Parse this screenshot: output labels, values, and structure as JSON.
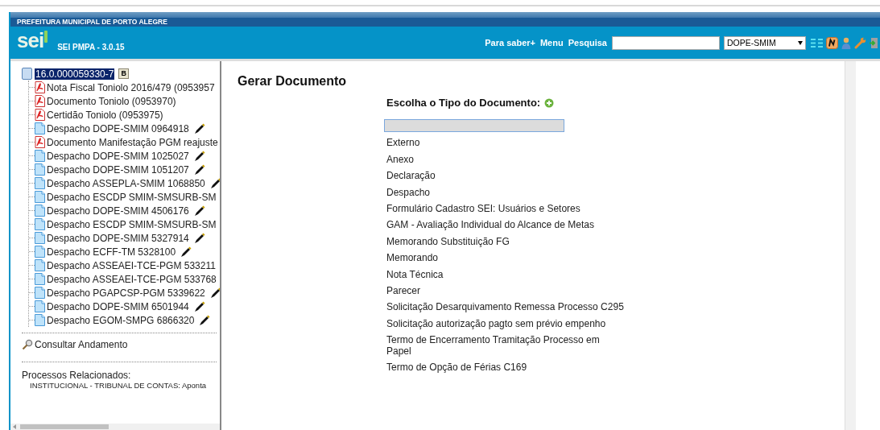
{
  "header": {
    "organization": "PREFEITURA MUNICIPAL DE PORTO ALEGRE",
    "logo": "sei",
    "version": "SEI PMPA - 3.0.15",
    "links": [
      "Para saber+",
      "Menu",
      "Pesquisa"
    ],
    "unit_select": {
      "value": "DOPE-SMIM"
    }
  },
  "tree": {
    "root": {
      "label": "16.0.000059330-7",
      "selected": true,
      "badge": "B",
      "children": [
        {
          "label": "Nota Fiscal Toniolo 2016/479 (0953957",
          "kind": "pdf",
          "signed": false
        },
        {
          "label": "Documento Toniolo (0953970)",
          "kind": "pdf",
          "signed": false
        },
        {
          "label": "Certidão Toniolo (0953975)",
          "kind": "pdf",
          "signed": false
        },
        {
          "label": "Despacho DOPE-SMIM 0964918",
          "kind": "doc",
          "signed": true
        },
        {
          "label": "Documento Manifestação PGM reajuste",
          "kind": "pdf",
          "signed": false
        },
        {
          "label": "Despacho DOPE-SMIM 1025027",
          "kind": "doc",
          "signed": true
        },
        {
          "label": "Despacho DOPE-SMIM 1051207",
          "kind": "doc",
          "signed": true
        },
        {
          "label": "Despacho ASSEPLA-SMIM 1068850",
          "kind": "doc",
          "signed": true
        },
        {
          "label": "Despacho ESCDP SMIM-SMSURB-SM",
          "kind": "doc",
          "signed": false
        },
        {
          "label": "Despacho DOPE-SMIM 4506176",
          "kind": "doc",
          "signed": true
        },
        {
          "label": "Despacho ESCDP SMIM-SMSURB-SM",
          "kind": "doc",
          "signed": false
        },
        {
          "label": "Despacho DOPE-SMIM 5327914",
          "kind": "doc",
          "signed": true
        },
        {
          "label": "Despacho ECFF-TM 5328100",
          "kind": "doc",
          "signed": true
        },
        {
          "label": "Despacho ASSEAEI-TCE-PGM 533211",
          "kind": "doc",
          "signed": false
        },
        {
          "label": "Despacho ASSEAEI-TCE-PGM 533768",
          "kind": "doc",
          "signed": false
        },
        {
          "label": "Despacho PGAPCSP-PGM 5339622",
          "kind": "doc",
          "signed": true
        },
        {
          "label": "Despacho DOPE-SMIM 6501944",
          "kind": "doc",
          "signed": true
        },
        {
          "label": "Despacho EGOM-SMPG 6866320",
          "kind": "doc",
          "signed": true
        }
      ]
    }
  },
  "consult_link": "Consultar Andamento",
  "related": {
    "title": "Processos Relacionados:",
    "items": [
      "INSTITUCIONAL - TRIBUNAL DE CONTAS: Aponta"
    ]
  },
  "main": {
    "title": "Gerar Documento",
    "prompt": "Escolha o Tipo do Documento:",
    "types": [
      "Externo",
      "Anexo",
      "Declaração",
      "Despacho",
      "Formulário Cadastro SEI: Usuários e Setores",
      "GAM - Avaliação Individual do Alcance de Metas",
      "Memorando Substituição FG",
      "Memorando",
      "Nota Técnica",
      "Parecer",
      "Solicitação Desarquivamento Remessa Processo C295",
      "Solicitação autorização pagto sem prévio empenho",
      "Termo de Encerramento Tramitação Processo em Papel",
      "Termo de Opção de Férias C169"
    ]
  }
}
